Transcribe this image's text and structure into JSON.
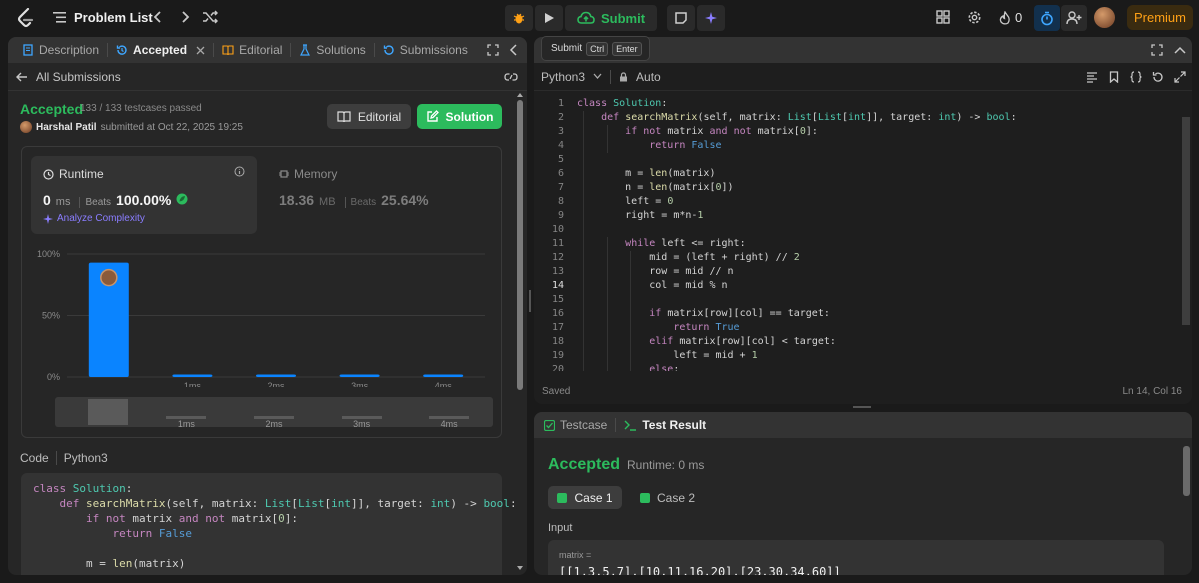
{
  "topbar": {
    "problem_list_label": "Problem List",
    "submit_label": "Submit",
    "streak_count": "0",
    "premium_label": "Premium"
  },
  "left_tabs": {
    "description": "Description",
    "accepted": "Accepted",
    "editorial": "Editorial",
    "solutions": "Solutions",
    "submissions": "Submissions"
  },
  "all_submissions": "All Submissions",
  "submission": {
    "status": "Accepted",
    "testcases": "133 / 133 testcases passed",
    "user": "Harshal Patil",
    "submitted_text": "submitted at Oct 22, 2025 19:25",
    "editorial_btn": "Editorial",
    "solution_btn": "Solution"
  },
  "runtime": {
    "label": "Runtime",
    "value": "0",
    "unit": "ms",
    "beats_label": "Beats",
    "beats": "100.00%",
    "analyze": "Analyze Complexity"
  },
  "memory": {
    "label": "Memory",
    "value": "18.36",
    "unit": "MB",
    "beats_label": "Beats",
    "beats": "25.64%"
  },
  "chart_data": {
    "type": "bar",
    "categories": [
      "",
      "1ms",
      "2ms",
      "3ms",
      "4ms"
    ],
    "values": [
      93,
      2,
      2,
      2,
      2
    ],
    "ylim": [
      0,
      100
    ],
    "yticks": [
      "0%",
      "50%",
      "100%"
    ],
    "minimap_labels": [
      "1ms",
      "2ms",
      "3ms",
      "4ms"
    ],
    "bar_color": "#0a84ff"
  },
  "code_section": {
    "label": "Code",
    "lang": "Python3",
    "lines": [
      "class Solution:",
      "    def searchMatrix(self, matrix: List[List[int]], target: int) -> bool:",
      "        if not matrix and not matrix[0]:",
      "            return False",
      "",
      "        m = len(matrix)"
    ]
  },
  "editor": {
    "tooltip_submit": "Submit",
    "tooltip_ctrl": "Ctrl",
    "tooltip_enter": "Enter",
    "language": "Python3",
    "auto": "Auto",
    "line_numbers": [
      "1",
      "2",
      "3",
      "4",
      "5",
      "6",
      "7",
      "8",
      "9",
      "10",
      "11",
      "12",
      "13",
      "14",
      "15",
      "16",
      "17",
      "18",
      "19",
      "20"
    ],
    "lines": [
      "class Solution:",
      "    def searchMatrix(self, matrix: List[List[int]], target: int) -> bool:",
      "        if not matrix and not matrix[0]:",
      "            return False",
      "",
      "        m = len(matrix)",
      "        n = len(matrix[0])",
      "        left = 0",
      "        right = m*n-1",
      "",
      "        while left <= right:",
      "            mid = (left + right) // 2",
      "            row = mid // n",
      "            col = mid % n",
      "",
      "            if matrix[row][col] == target:",
      "                return True",
      "            elif matrix[row][col] < target:",
      "                left = mid + 1",
      "            else:"
    ],
    "saved": "Saved",
    "cursor": "Ln 14, Col 16"
  },
  "result": {
    "tab_testcase": "Testcase",
    "tab_result": "Test Result",
    "status": "Accepted",
    "runtime": "Runtime: 0 ms",
    "case1": "Case 1",
    "case2": "Case 2",
    "input_label": "Input",
    "input_name": "matrix =",
    "input_value": "[[1,3,5,7],[10,11,16,20],[23,30,34,60]]"
  },
  "colors": {
    "accent_green": "#2cbb5d",
    "premium_orange": "#ffa116",
    "ai_purple": "#8a7dff",
    "keyword": "#c586c0",
    "function": "#dcdcaa",
    "type": "#4ec9b0",
    "number": "#b5cea8"
  }
}
